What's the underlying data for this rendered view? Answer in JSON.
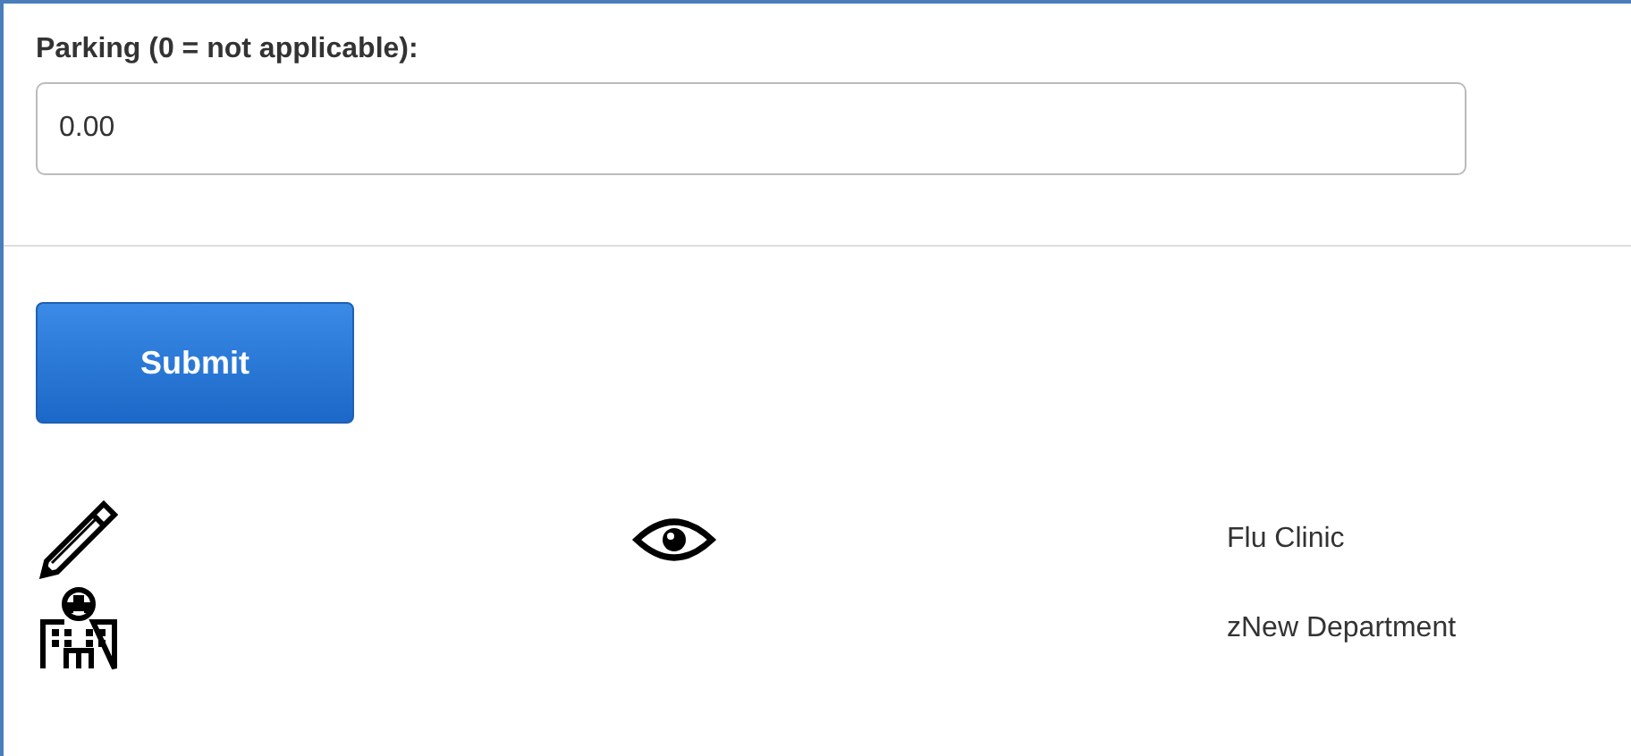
{
  "form": {
    "label": "Parking (0 = not applicable):",
    "value": "0.00"
  },
  "submit": {
    "label": "Submit"
  },
  "rows": [
    {
      "kind": "editable",
      "name": "Flu Clinic"
    },
    {
      "kind": "department",
      "name": "zNew Department"
    }
  ]
}
